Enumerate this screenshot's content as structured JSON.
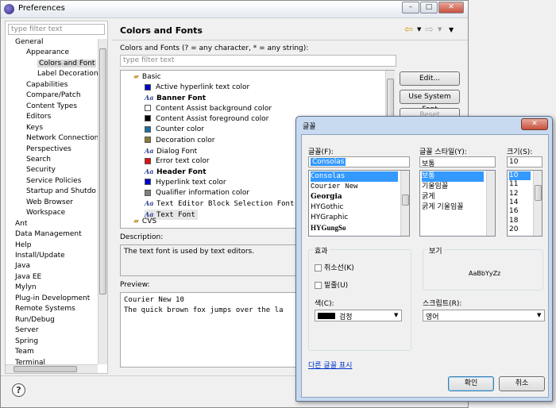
{
  "window": {
    "title": "Preferences"
  },
  "nav": {
    "filter_placeholder": "type filter text",
    "items": [
      {
        "label": "General",
        "indent": 0
      },
      {
        "label": "Appearance",
        "indent": 1
      },
      {
        "label": "Colors and Font",
        "indent": 2,
        "selected": true
      },
      {
        "label": "Label Decoration",
        "indent": 2
      },
      {
        "label": "Capabilities",
        "indent": 1
      },
      {
        "label": "Compare/Patch",
        "indent": 1
      },
      {
        "label": "Content Types",
        "indent": 1
      },
      {
        "label": "Editors",
        "indent": 1
      },
      {
        "label": "Keys",
        "indent": 1
      },
      {
        "label": "Network Connection",
        "indent": 1
      },
      {
        "label": "Perspectives",
        "indent": 1
      },
      {
        "label": "Search",
        "indent": 1
      },
      {
        "label": "Security",
        "indent": 1
      },
      {
        "label": "Service Policies",
        "indent": 1
      },
      {
        "label": "Startup and Shutdo",
        "indent": 1
      },
      {
        "label": "Web Browser",
        "indent": 1
      },
      {
        "label": "Workspace",
        "indent": 1
      },
      {
        "label": "Ant",
        "indent": 0
      },
      {
        "label": "Data Management",
        "indent": 0
      },
      {
        "label": "Help",
        "indent": 0
      },
      {
        "label": "Install/Update",
        "indent": 0
      },
      {
        "label": "Java",
        "indent": 0
      },
      {
        "label": "Java EE",
        "indent": 0
      },
      {
        "label": "Mylyn",
        "indent": 0
      },
      {
        "label": "Plug-in Development",
        "indent": 0
      },
      {
        "label": "Remote Systems",
        "indent": 0
      },
      {
        "label": "Run/Debug",
        "indent": 0
      },
      {
        "label": "Server",
        "indent": 0
      },
      {
        "label": "Spring",
        "indent": 0
      },
      {
        "label": "Team",
        "indent": 0
      },
      {
        "label": "Terminal",
        "indent": 0
      }
    ]
  },
  "page": {
    "title": "Colors and Fonts",
    "subtitle": "Colors and Fonts (? = any character, * = any string):",
    "filter_placeholder": "type filter text",
    "group_basic": "Basic",
    "group_cvs": "CVS",
    "entries": [
      {
        "label": "Active hyperlink text color",
        "kind": "color",
        "color": "#0000cc"
      },
      {
        "label": "Banner Font",
        "kind": "font",
        "bold": true
      },
      {
        "label": "Content Assist background color",
        "kind": "color",
        "color": "#ffffff"
      },
      {
        "label": "Content Assist foreground color",
        "kind": "color",
        "color": "#000000"
      },
      {
        "label": "Counter color",
        "kind": "color",
        "color": "#1f6fa0"
      },
      {
        "label": "Decoration color",
        "kind": "color",
        "color": "#8a7a3a"
      },
      {
        "label": "Dialog Font",
        "kind": "font"
      },
      {
        "label": "Error text color",
        "kind": "color",
        "color": "#e01010"
      },
      {
        "label": "Header Font",
        "kind": "font",
        "bold": true
      },
      {
        "label": "Hyperlink text color",
        "kind": "color",
        "color": "#0000cc"
      },
      {
        "label": "Qualifier information color",
        "kind": "color",
        "color": "#808080"
      },
      {
        "label": "Text Editor Block Selection Font",
        "kind": "font",
        "mono": true
      },
      {
        "label": "Text Font",
        "kind": "font",
        "mono": true,
        "selected": true
      }
    ],
    "font_icon": "Aa",
    "buttons": {
      "edit": "Edit...",
      "use_system_font": "Use System Font",
      "reset": "Reset"
    },
    "description_label": "Description:",
    "description_text": "The text font is used by text editors.",
    "preview_label": "Preview:",
    "preview_line1": "Courier New 10",
    "preview_line2": "The quick brown fox jumps over the la"
  },
  "dialog": {
    "title": "글꼴",
    "font_label": "글꼴(F):",
    "font_value": "Consolas",
    "fonts": [
      "Consolas",
      "Courier New",
      "Georgia",
      "HYGothic",
      "HYGraphic",
      "HYGungSo"
    ],
    "style_label": "글꼴 스타일(Y):",
    "style_value": "보통",
    "styles": [
      "보통",
      "기울임꼴",
      "굵게",
      "굵게 기울임꼴"
    ],
    "size_label": "크기(S):",
    "size_value": "10",
    "sizes": [
      "10",
      "11",
      "12",
      "14",
      "16",
      "18",
      "20"
    ],
    "effects_label": "효과",
    "strikeout_label": "취소선(K)",
    "underline_label": "밑줄(U)",
    "color_label": "색(C):",
    "color_value": "검정",
    "sample_label": "보기",
    "sample_text": "AaBbYyZz",
    "script_label": "스크립트(R):",
    "script_value": "영어",
    "more_fonts_link": "다른 글꼴 표시",
    "ok_label": "확인",
    "cancel_label": "취소"
  }
}
